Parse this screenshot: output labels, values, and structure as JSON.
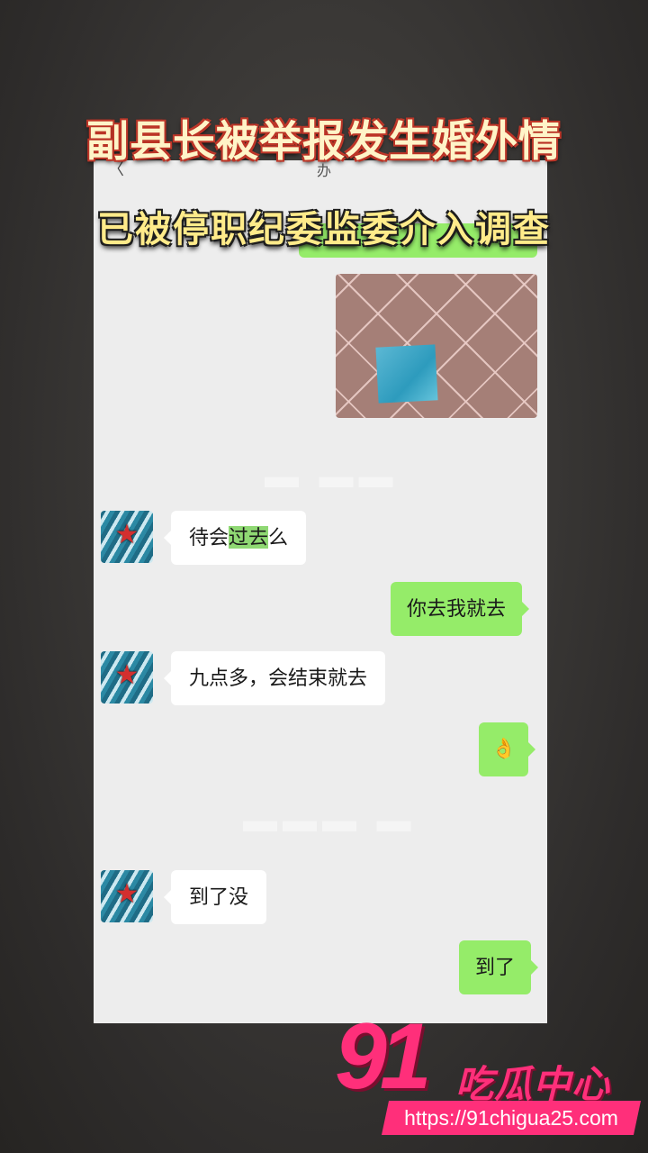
{
  "headline": {
    "line1": "副县长被举报发生婚外情",
    "line2": "已被停职纪委监委介入调查"
  },
  "chat": {
    "back_glyph": "〈",
    "title_partial": "办"
  },
  "messages": [
    {
      "side": "in",
      "text_before": "待会",
      "text_highlight": "过去",
      "text_after": "么"
    },
    {
      "side": "out",
      "text": "你去我就去"
    },
    {
      "side": "in",
      "text": "九点多，会结束就去"
    },
    {
      "side": "out",
      "emoji": "👌"
    },
    {
      "side": "in",
      "text": "到了没"
    },
    {
      "side": "out",
      "text": "到了"
    }
  ],
  "watermark": {
    "brand_number": "91",
    "brand_text": "吃瓜中心",
    "url": "https://91chigua25.com"
  },
  "colors": {
    "outgoing_bubble": "#95ec69",
    "incoming_bubble": "#ffffff",
    "brand_pink": "#ff2f7a",
    "chat_bg": "#ededed"
  }
}
